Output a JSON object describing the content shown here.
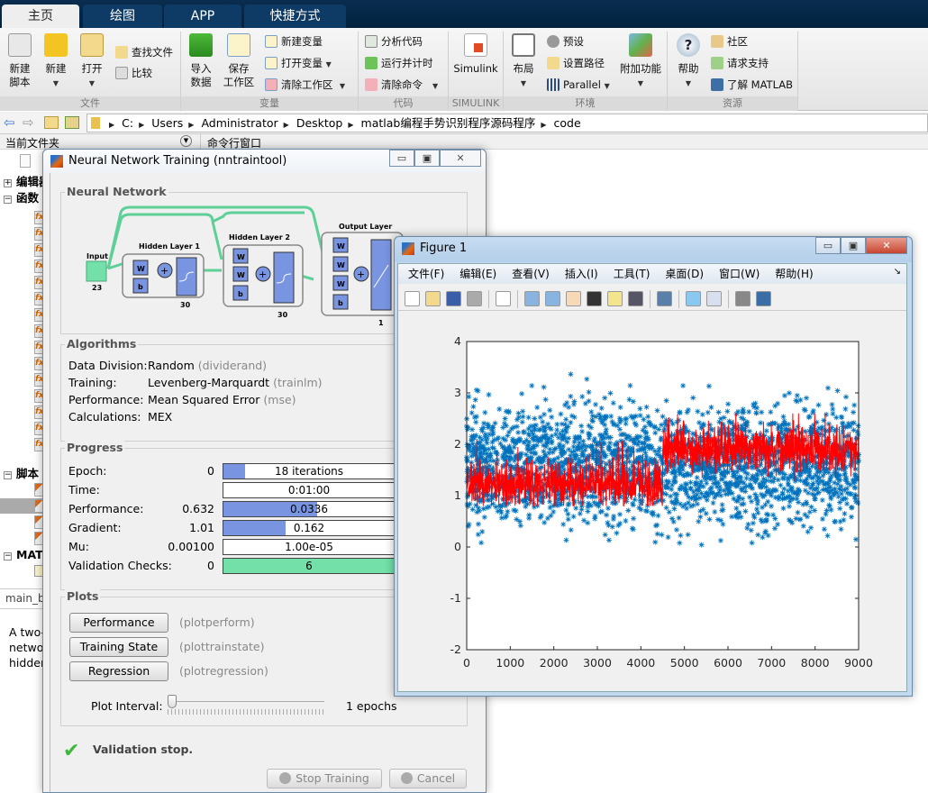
{
  "tabs": [
    {
      "label": "主页",
      "active": true
    },
    {
      "label": "绘图"
    },
    {
      "label": "APP"
    },
    {
      "label": "快捷方式"
    }
  ],
  "ribbon": {
    "file": {
      "section": "文件",
      "new_script": "新建\n脚本",
      "new": "新建",
      "open": "打开",
      "find_files": "查找文件",
      "compare": "比较"
    },
    "variable": {
      "section": "变量",
      "import": "导入\n数据",
      "save_ws": "保存\n工作区",
      "new_var": "新建变量",
      "open_var": "打开变量",
      "clear_ws": "清除工作区"
    },
    "code": {
      "section": "代码",
      "analyze": "分析代码",
      "run_time": "运行并计时",
      "clear_cmd": "清除命令"
    },
    "simulink": {
      "section": "SIMULINK",
      "label": "Simulink"
    },
    "env": {
      "section": "环境",
      "layout": "布局",
      "prefs": "预设",
      "set_path": "设置路径",
      "parallel": "Parallel",
      "addons": "附加功能"
    },
    "resources": {
      "section": "资源",
      "help": "帮助",
      "community": "社区",
      "support": "请求支持",
      "learn": "了解 MATLAB"
    }
  },
  "address": {
    "crumbs": [
      "C:",
      "Users",
      "Administrator",
      "Desktop",
      "matlab编程手势识别程序源码程序",
      "code"
    ]
  },
  "panels": {
    "current_folder": "当前文件夹",
    "command_window": "命令行窗口"
  },
  "tree": {
    "editor": "编辑器",
    "functions": "函数",
    "scripts": "脚本",
    "mat": "MATLAB",
    "details_file": "main_b",
    "details_text": [
      "A two-",
      "netwo",
      "hidden"
    ]
  },
  "nntool": {
    "title": "Neural Network Training (nntraintool)",
    "network": {
      "label": "Neural Network",
      "input": "Input",
      "input_size": "23",
      "h1": "Hidden Layer 1",
      "h1_size": "30",
      "h2": "Hidden Layer 2",
      "h2_size": "30",
      "out": "Output Layer",
      "out_size": "1",
      "w": "W",
      "b": "b"
    },
    "algorithms": {
      "label": "Algorithms",
      "rows": [
        {
          "k": "Data Division:",
          "v": "Random",
          "f": "(dividerand)"
        },
        {
          "k": "Training:",
          "v": "Levenberg-Marquardt",
          "f": "(trainlm)"
        },
        {
          "k": "Performance:",
          "v": "Mean Squared Error",
          "f": "(mse)"
        },
        {
          "k": "Calculations:",
          "v": "MEX",
          "f": ""
        }
      ]
    },
    "progress": {
      "label": "Progress",
      "rows": [
        {
          "k": "Epoch:",
          "start": "0",
          "cur": "18 iterations",
          "fill": 0.09,
          "color": "#7994e0"
        },
        {
          "k": "Time:",
          "start": "",
          "cur": "0:01:00",
          "fill": 0,
          "color": "#7994e0"
        },
        {
          "k": "Performance:",
          "start": "0.632",
          "cur": "0.0336",
          "fill": 0.39,
          "color": "#7994e0"
        },
        {
          "k": "Gradient:",
          "start": "1.01",
          "cur": "0.162",
          "fill": 0.26,
          "color": "#7994e0"
        },
        {
          "k": "Mu:",
          "start": "0.00100",
          "cur": "1.00e-05",
          "fill": 0,
          "color": "#7994e0"
        },
        {
          "k": "Validation Checks:",
          "start": "0",
          "cur": "6",
          "fill": 1,
          "color": "#72e0a8"
        }
      ]
    },
    "plots": {
      "label": "Plots",
      "buttons": [
        {
          "label": "Performance",
          "fn": "(plotperform)"
        },
        {
          "label": "Training State",
          "fn": "(plottrainstate)"
        },
        {
          "label": "Regression",
          "fn": "(plotregression)"
        }
      ],
      "interval_label": "Plot Interval:",
      "interval_value": "1 epochs",
      "slider_fraction": 0
    },
    "status": "Validation stop.",
    "stop": "Stop Training",
    "cancel": "Cancel"
  },
  "figure": {
    "title": "Figure 1",
    "menu": [
      "文件(F)",
      "编辑(E)",
      "查看(V)",
      "插入(I)",
      "工具(T)",
      "桌面(D)",
      "窗口(W)",
      "帮助(H)"
    ],
    "toolbar": [
      "new-icon",
      "open-icon",
      "save-icon",
      "print-icon",
      "pointer-icon",
      "zoom-in-icon",
      "zoom-out-icon",
      "pan-icon",
      "rotate-icon",
      "data-cursor-icon",
      "brush-icon",
      "link-icon",
      "colorbar-icon",
      "legend-icon",
      "hide-tools-icon",
      "show-tools-icon"
    ]
  },
  "chart_data": {
    "type": "scatter",
    "xlim": [
      0,
      9000
    ],
    "ylim": [
      -2,
      4
    ],
    "xticks": [
      "0",
      "1000",
      "2000",
      "3000",
      "4000",
      "5000",
      "6000",
      "7000",
      "8000",
      "9000"
    ],
    "yticks": [
      "-2",
      "-1",
      "0",
      "1",
      "2",
      "3",
      "4"
    ],
    "grid": false,
    "series": [
      {
        "kind": "scatter",
        "marker": "*",
        "color": "#0072bd",
        "x_range": [
          0,
          9000
        ],
        "y_typical": [
          0.2,
          3.0
        ],
        "y_center": 1.6,
        "y_min": -1,
        "y_max": 4
      },
      {
        "kind": "line",
        "color": "#ff0000",
        "x_range": [
          0,
          9000
        ],
        "segments": [
          {
            "x": [
              0,
              4500
            ],
            "y_center": 1.2,
            "y_band": [
              0.8,
              2.1
            ]
          },
          {
            "x": [
              4500,
              9000
            ],
            "y_center": 1.9,
            "y_band": [
              1.2,
              2.6
            ]
          }
        ]
      }
    ]
  }
}
